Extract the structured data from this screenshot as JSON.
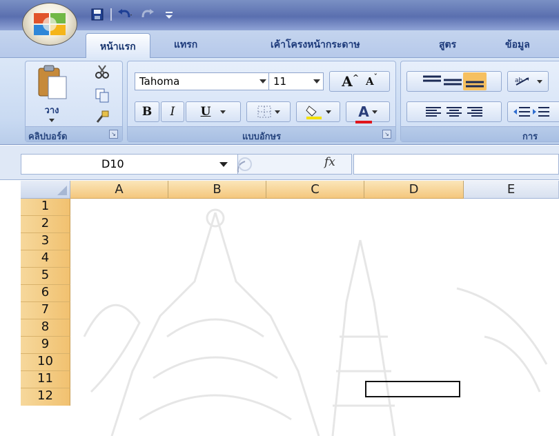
{
  "app": {
    "colors": {
      "ribbon": "#c9daf2",
      "titlebar": "#5a6faf",
      "header_highlight": "#f4c77d",
      "text_blue": "#1d3a7a"
    }
  },
  "quick_access": {
    "icons": [
      "save-icon",
      "undo-icon",
      "redo-icon",
      "customize-icon"
    ]
  },
  "tabs": [
    {
      "label": "หน้าแรก",
      "active": true
    },
    {
      "label": "แทรก"
    },
    {
      "label": "เค้าโครงหน้ากระดาษ"
    },
    {
      "label": "สูตร"
    },
    {
      "label": "ข้อมูล"
    }
  ],
  "ribbon": {
    "clipboard": {
      "paste_label": "วาง",
      "group_label": "คลิปบอร์ด"
    },
    "font": {
      "font_name": "Tahoma",
      "font_size": "11",
      "bold": "B",
      "italic": "I",
      "underline": "U",
      "group_label": "แบบอักษร",
      "grow_font": "A",
      "shrink_font": "A",
      "font_color": "A"
    },
    "alignment": {
      "group_label": "การ"
    }
  },
  "formula_bar": {
    "name_box": "D10",
    "fx_label": "fx",
    "formula": ""
  },
  "sheet": {
    "columns": [
      "A",
      "B",
      "C",
      "D",
      "E"
    ],
    "rows": [
      "1",
      "2",
      "3",
      "4",
      "5",
      "6",
      "7",
      "8",
      "9",
      "10",
      "11",
      "12"
    ],
    "selected_cell": "D10"
  }
}
